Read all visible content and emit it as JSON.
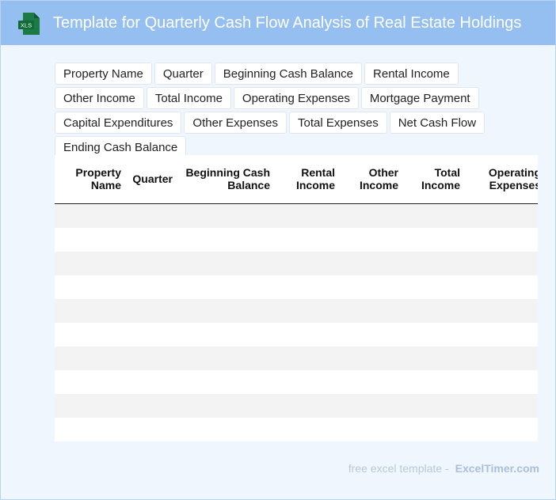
{
  "header": {
    "title": "Template for Quarterly Cash Flow Analysis of Real Estate Holdings",
    "icon": "xls-file-icon",
    "icon_label": "XLS",
    "accent_color": "#94bff0"
  },
  "tags": [
    "Property Name",
    "Quarter",
    "Beginning Cash Balance",
    "Rental Income",
    "Other Income",
    "Total Income",
    "Operating Expenses",
    "Mortgage Payment",
    "Capital Expenditures",
    "Other Expenses",
    "Total Expenses",
    "Net Cash Flow",
    "Ending Cash Balance"
  ],
  "table": {
    "columns": [
      "Property\nName",
      "Quarter",
      "Beginning Cash\nBalance",
      "Rental\nIncome",
      "Other\nIncome",
      "Total\nIncome",
      "Operating\nExpenses"
    ],
    "rows": [
      [],
      [],
      [],
      [],
      [],
      [],
      [],
      [],
      [],
      []
    ]
  },
  "footer": {
    "lead": "free excel template -",
    "brand": "ExcelTimer.com"
  }
}
